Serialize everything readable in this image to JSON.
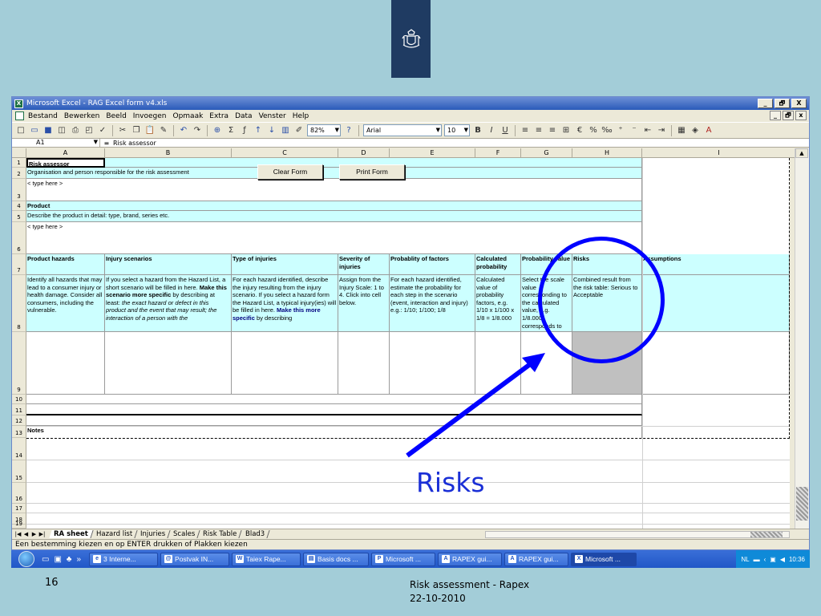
{
  "window": {
    "title": "Microsoft Excel - RAG Excel form v4.xls",
    "controls": [
      "_",
      "🗗",
      "X"
    ]
  },
  "menu": [
    "Bestand",
    "Bewerken",
    "Beeld",
    "Invoegen",
    "Opmaak",
    "Extra",
    "Data",
    "Venster",
    "Help"
  ],
  "toolbar": {
    "zoom": "82%",
    "font": "Arial",
    "font_size": "10"
  },
  "formula_bar": {
    "name_box": "A1",
    "fx": "=",
    "content": "Risk assessor"
  },
  "columns": [
    "A",
    "B",
    "C",
    "D",
    "E",
    "F",
    "G",
    "H",
    "I"
  ],
  "rows": [
    "1",
    "2",
    "3",
    "4",
    "5",
    "6",
    "7",
    "8",
    "9",
    "10",
    "11",
    "12",
    "13",
    "14",
    "15",
    "16",
    "17",
    "18",
    "19"
  ],
  "sheet": {
    "risk_assessor": "Risk assessor",
    "organisation": "Organisation and person responsible for the risk assessment",
    "type_here_1": "< type here >",
    "product": "Product",
    "describe_product": "Describe the product in detail: type, brand, series etc.",
    "type_here_2": "< type here >",
    "headers": {
      "product_hazards": "Product hazards",
      "injury_scenarios": "Injury scenarios",
      "type_of_injuries": "Type of injuries",
      "severity": "Severity of injuries",
      "probability_factors": "Probablity of factors",
      "calculated_probability": "Calculated probability",
      "probability_value": "Probability value",
      "risks": "Risks",
      "assumptions": "Assumptions"
    },
    "descriptions": {
      "a": "Identify all hazards that may lead to a consumer injury or health damage. Consider all consumers, including the vulnerable.",
      "b1": "If you select a hazard from the Hazard List, a short scenario will be filled in here.",
      "b2": "Make this scenario more specific",
      "b3": "by describing at least:",
      "b4": "the exact hazard or defect in this product and the event that may result; the interaction of a person with the",
      "c1": "For each hazard identified, describe the injury resulting from the injury scenario. If you select a hazard form the Hazard List, a typical injury(ies) will be filled in here.",
      "c2": "Make this more specific",
      "c3": "by describing",
      "d": "Assign from the Injury Scale: 1 to 4. Click into cell below.",
      "e": "For each hazard identified, estimate the probability for each step in the scenario (event, interaction and injury) e.g.: 1/10; 1/100; 1/8",
      "f": "Calculated value of probability factors, e.g. 1/10 x 1/100 x 1/8 = 1/8.000",
      "g": "Select the scale value corresponding to the calculated value, e.g. 1/8.000 corresponds to",
      "h": "Combined result from the risk table: Serious to Acceptable"
    },
    "notes": "Notes",
    "buttons": {
      "clear_form": "Clear Form",
      "print_form": "Print Form"
    }
  },
  "tabs": [
    "RA sheet",
    "Hazard list",
    "Injuries",
    "Scales",
    "Risk Table",
    "Blad3"
  ],
  "status": "Een bestemming kiezen en op ENTER drukken of Plakken kiezen",
  "taskbar": {
    "items": [
      "3 Interne...",
      "Postvak IN...",
      "Taiex Rape...",
      "Basis docs ...",
      "Microsoft ...",
      "RAPEX gui...",
      "RAPEX gui...",
      "Microsoft ..."
    ],
    "language": "NL",
    "clock": "10:36"
  },
  "annotation": {
    "label": "Risks",
    "color": "#0000ff"
  },
  "slide": {
    "number": "16",
    "footer_title": "Risk assessment - Rapex",
    "footer_date": "22-10-2010"
  },
  "colors": {
    "slide_bg": "#a3cdd8",
    "logo_bg": "#1f3b62",
    "header_fill": "#ccffff",
    "risk_cell_fill": "#c0c0c0"
  }
}
